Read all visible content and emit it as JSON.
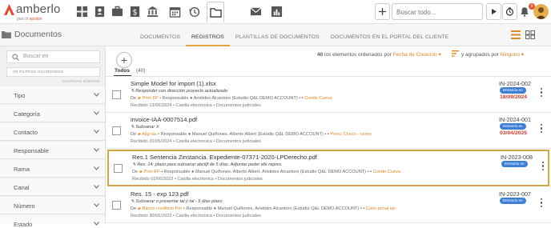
{
  "app": {
    "logo_text": "amberlo",
    "logo_sub_prefix": "part of",
    "logo_sub_brand": "epsilon"
  },
  "topbar": {
    "search_placeholder": "Buscar todo...",
    "notifications_count": "9",
    "nav_icons": [
      "dashboard-icon",
      "contacts-icon",
      "briefcase-icon",
      "billing-icon",
      "bank-icon",
      "calendar-icon",
      "history-icon",
      "documents-icon",
      "mail-icon",
      "reports-icon"
    ],
    "right_icons": [
      "add-icon",
      "play-icon",
      "timer-icon",
      "bell-icon"
    ]
  },
  "subbar": {
    "section_title": "Documentos",
    "tabs": [
      {
        "label": "DOCUMENTOS",
        "active": false
      },
      {
        "label": "REGISTROS",
        "active": true
      },
      {
        "label": "PLANTILLAS DE DOCUMENTOS",
        "active": false
      },
      {
        "label": "DOCUMENTOS EN EL PORTAL DEL CLIENTE",
        "active": false
      }
    ]
  },
  "sidebar": {
    "search_placeholder": "Buscar en",
    "saved_filters": "(0) FILTROS GUARDADOS",
    "actions": "GUARDAR    BORRAR",
    "filters": [
      "Tipo",
      "Categoría",
      "Contacto",
      "Responsable",
      "Rama",
      "Canal",
      "Número",
      "Estado"
    ]
  },
  "list": {
    "add_label": "+",
    "tab_label": "Todos",
    "tab_count": "(40)",
    "count_prefix": "40",
    "count_text": "los elementos ordenados por",
    "sort_field": "Fecha de Creación",
    "group_text": "y agrupados por",
    "group_field": "Ninguno",
    "records": [
      {
        "title": "Simple Model for import (1).xlsx",
        "note": "Responder con dirección proyecto actualizado",
        "type_label": "De",
        "folder": "Prim FP",
        "responsable_label": "Responsable",
        "responsable": "Aristides Alcantoro (Estudio Q&L DEMO ACCOUNT)",
        "case": "Conde Cueva",
        "received": "Recibido 13/06/2024",
        "channel": "Casilla electronica",
        "category": "Documentos judiciales",
        "code": "IN-2024-002",
        "status": "Entrando en",
        "date": "18/09/2024",
        "date_color": "#d63a2a",
        "selected": false
      },
      {
        "title": "invoice-IAA-0007514.pdf",
        "note": "Subsanar X",
        "type_label": "De",
        "folder": "Alig-las",
        "responsable_label": "Responsable",
        "responsable": "Manuel Quiñones. Alberto Albert (Estudio Q&L DEMO ACCOUNT)",
        "case": "Perez Checo - xxxxx",
        "received": "Recibido 31/05/2024",
        "channel": "Casilla electronica",
        "category": "Documentos judiciales",
        "code": "IN-2024-001",
        "status": "Entrando en",
        "date": "03/04/2025",
        "date_color": "#d63a2a",
        "selected": false
      },
      {
        "title": "Res.1 Sentencia Zinstancia. Expediente-07371-2020-LPDerecho.pdf",
        "note": "Res. 14: plazo para subsanar abciljf de 5 días. Adjuntar poder efe repres.",
        "type_label": "De",
        "folder": "Prim FP",
        "responsable_label": "Responsable",
        "responsable": "Manuel Quiñones. Alberto Albert. Aristides Alcantoro (Estudio Q&L DEMO ACCOUNT)",
        "case": "Conde Cueva",
        "received": "Recibido 02/06/2023",
        "channel": "Casilla electronica",
        "category": "Documentos judiciales",
        "code": "IN-2023-008",
        "status": "Entrando en",
        "date": "",
        "date_color": "#d63a2a",
        "selected": true
      },
      {
        "title": "Res. 15 - exp 123.pdf",
        "note": "Subsanar o presentar tal y tal - 5 días plazo",
        "type_label": "De",
        "folder": "Banco crediticio Per",
        "responsable_label": "Responsable",
        "responsable": "Manuel Quiñones. Aristides Alcantoro (Estudio Q&L DEMO ACCOUNT)",
        "case": "Caso penal ejx",
        "received": "Recibido 30/05/2023",
        "channel": "Casilla electronica",
        "category": "Documentos judiciales",
        "code": "IN-2023-007",
        "status": "Entrando en",
        "date": "",
        "date_color": "#d63a2a",
        "selected": false
      }
    ]
  },
  "colors": {
    "accent": "#e08a22",
    "status_blue": "#3d7fd6",
    "overdue_red": "#d63a2a",
    "selection_border": "#d2a640"
  }
}
